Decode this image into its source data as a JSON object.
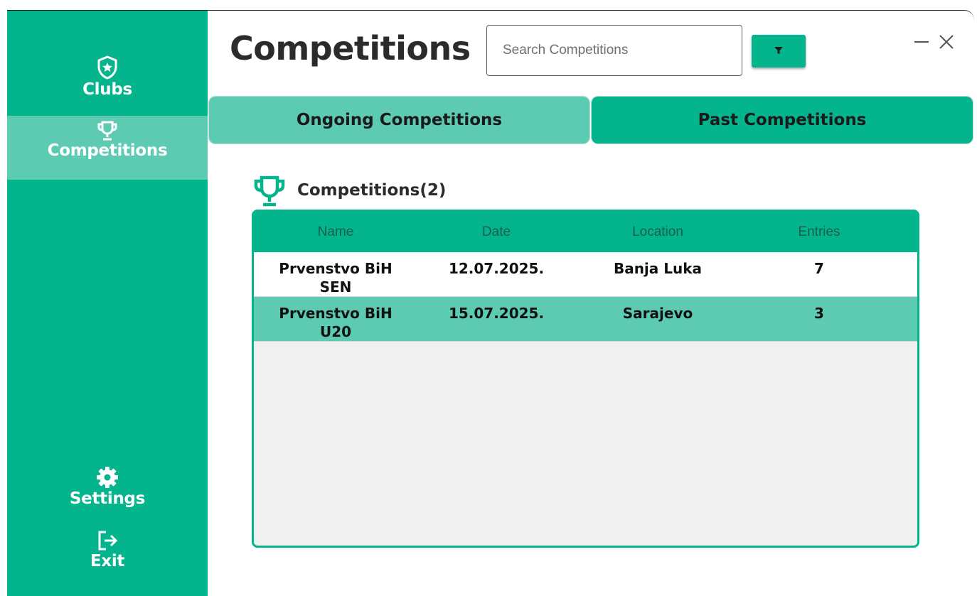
{
  "sidebar": {
    "items": [
      {
        "label": "Clubs",
        "icon": "shield-star-icon"
      },
      {
        "label": "Competitions",
        "icon": "trophy-icon"
      },
      {
        "label": "Settings",
        "icon": "gear-icon"
      },
      {
        "label": "Exit",
        "icon": "exit-icon"
      }
    ],
    "active": "Competitions"
  },
  "header": {
    "title": "Competitions",
    "search_placeholder": "Search Competitions",
    "filter_icon": "filter-icon"
  },
  "tabs": [
    {
      "label": "Ongoing Competitions"
    },
    {
      "label": "Past Competitions"
    }
  ],
  "section": {
    "title": "Competitions(2)",
    "icon": "trophy-icon"
  },
  "table": {
    "columns": [
      "Name",
      "Date",
      "Location",
      "Entries"
    ],
    "rows": [
      {
        "name_line1": "Prvenstvo BiH",
        "name_line2": "SEN",
        "date": "12.07.2025.",
        "location": "Banja Luka",
        "entries": "7"
      },
      {
        "name_line1": "Prvenstvo BiH",
        "name_line2": "U20",
        "date": "15.07.2025.",
        "location": "Sarajevo",
        "entries": "3"
      }
    ]
  },
  "colors": {
    "primary": "#04b48d",
    "selected": "#5ccbb2",
    "header_text": "#15604f",
    "table_bg": "#f0f0f0"
  }
}
